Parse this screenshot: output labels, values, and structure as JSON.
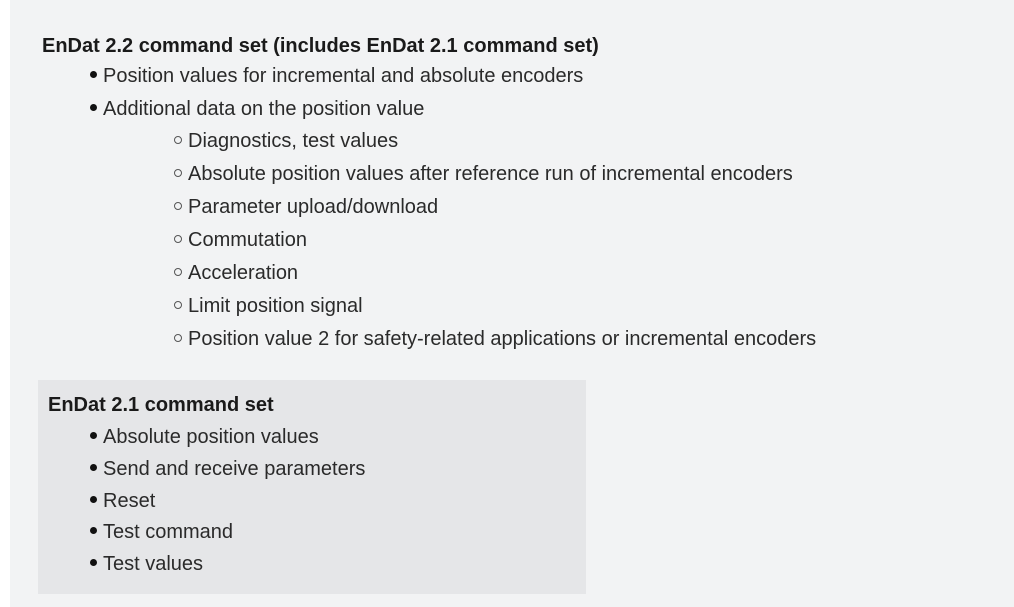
{
  "section_21_plus": {
    "heading": "EnDat 2.2 command set (includes EnDat 2.1 command set)",
    "items": [
      "Position values for incremental and absolute encoders",
      "Additional data on the position value"
    ],
    "subitems": [
      "Diagnostics, test values",
      "Absolute position values after reference run of incremental encoders",
      "Parameter upload/download",
      "Commutation",
      "Acceleration",
      "Limit position signal",
      "Position value 2 for safety-related applications or incremental encoders"
    ]
  },
  "section_21": {
    "heading": "EnDat 2.1 command set",
    "items": [
      "Absolute position values",
      "Send and receive parameters",
      "Reset",
      "Test command",
      "Test values"
    ]
  }
}
